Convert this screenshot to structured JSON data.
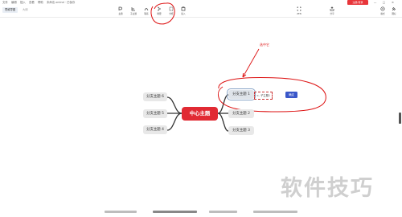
{
  "menu": {
    "items": [
      "文件",
      "编辑",
      "插入",
      "查看",
      "帮助"
    ],
    "doc_title": "未命名.xmind · 已保存",
    "signup_label": "注册/登录",
    "window_buttons": [
      "—",
      "□",
      "×"
    ]
  },
  "toolbar": {
    "tabs": [
      "思维导图",
      "大纲"
    ],
    "center_tools": [
      "主题",
      "子主题",
      "联系",
      "概要",
      "外框",
      "插入"
    ],
    "right_tools": [
      "ZEN",
      "分享"
    ],
    "far_right_tools": [
      "格式",
      "图标"
    ]
  },
  "mindmap": {
    "central": "中心主题",
    "left_branches": [
      "分支主题 6",
      "分支主题 5",
      "分支主题 4"
    ],
    "right_branches": [
      "分支主题 1",
      "分支主题 2",
      "分支主题 3"
    ],
    "selected_branch_index": 0
  },
  "callout": {
    "tooltip_text": "<- 子主题1",
    "confirm_label": "确定",
    "annotation": "选中它"
  },
  "watermark": "软件技巧",
  "colors": {
    "central_bg": "#e12a33",
    "confirm_bg": "#3a57c9",
    "annotation": "#d11111"
  }
}
